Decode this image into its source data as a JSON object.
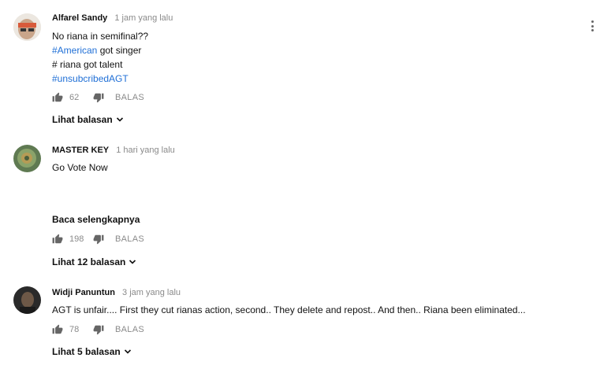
{
  "comments": [
    {
      "author": "Alfarel Sandy",
      "time": "1 jam yang lalu",
      "lines": [
        {
          "text": "No riana in semifinal??"
        },
        {
          "hashtag": "#American",
          "rest": " got singer"
        },
        {
          "text": "# riana got talent"
        },
        {
          "hashtag": "#unsubcribedAGT",
          "rest": ""
        }
      ],
      "likes": "62",
      "reply_label": "BALAS",
      "replies_label": "Lihat balasan"
    },
    {
      "author": "MASTER KEY",
      "time": "1 hari yang lalu",
      "lines": [
        {
          "text": "Go Vote Now"
        }
      ],
      "read_more": "Baca selengkapnya",
      "likes": "198",
      "reply_label": "BALAS",
      "replies_label": "Lihat 12 balasan"
    },
    {
      "author": "Widji Panuntun",
      "time": "3 jam yang lalu",
      "lines": [
        {
          "text": "AGT is unfair.... First they cut rianas action, second.. They delete and repost.. And then.. Riana been eliminated..."
        }
      ],
      "likes": "78",
      "reply_label": "BALAS",
      "replies_label": "Lihat 5 balasan"
    }
  ],
  "icons": {
    "like": "thumbs-up-icon",
    "dislike": "thumbs-down-icon",
    "menu": "more-vert-icon",
    "expand": "chevron-down-icon"
  },
  "colors": {
    "hashtag": "#1f6fd6",
    "meta": "#8a8a8a"
  }
}
